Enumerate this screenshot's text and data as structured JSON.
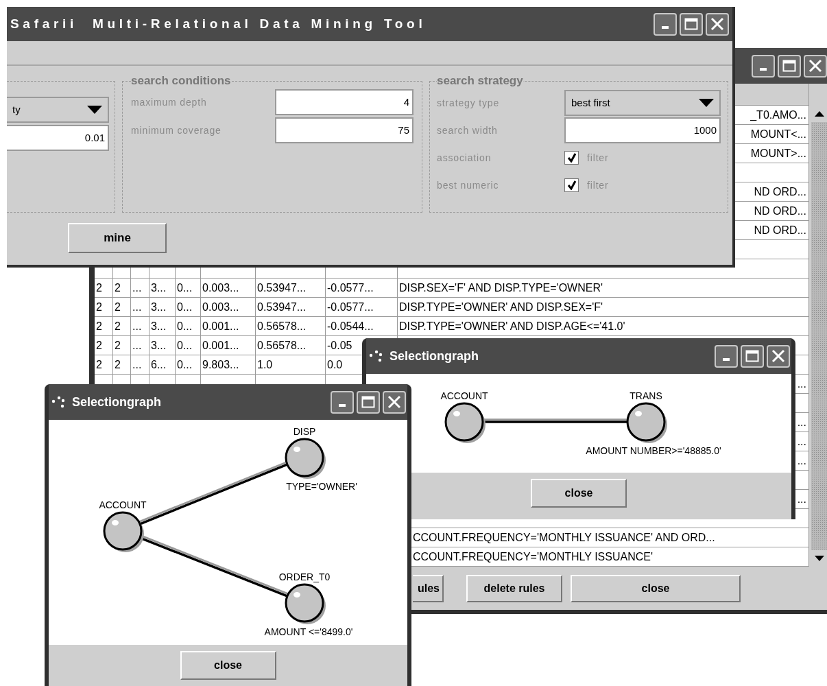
{
  "main_window": {
    "title": "Safarii  Multi-Relational Data Mining Tool",
    "left_panel": {
      "selector_value": "ty",
      "field_value": "0.01"
    },
    "search_conditions": {
      "title": "search conditions",
      "fields": [
        {
          "label": "maximum depth",
          "value": "4"
        },
        {
          "label": "minimum coverage",
          "value": "75"
        }
      ]
    },
    "search_strategy": {
      "title": "search strategy",
      "rows": [
        {
          "kind": "combo",
          "label": "strategy type",
          "value": "best first"
        },
        {
          "kind": "field",
          "label": "search width",
          "value": "1000"
        },
        {
          "kind": "checkbox",
          "label": "association",
          "checked": true,
          "text": "filter"
        },
        {
          "kind": "checkbox",
          "label": "best numeric",
          "checked": true,
          "text": "filter"
        }
      ]
    },
    "mine_button": "mine"
  },
  "results_window": {
    "rows": [
      {
        "kind": "tail",
        "rule": "_T0.AMO..."
      },
      {
        "kind": "tail",
        "rule": "MOUNT<..."
      },
      {
        "kind": "tail",
        "rule": "MOUNT>..."
      },
      {
        "kind": "blank"
      },
      {
        "kind": "tail",
        "rule": "ND ORD..."
      },
      {
        "kind": "tail",
        "rule": "ND ORD..."
      },
      {
        "kind": "tail",
        "rule": "ND ORD..."
      },
      {
        "kind": "blank"
      },
      {
        "kind": "blank"
      },
      {
        "kind": "full",
        "values": [
          "2",
          "2",
          "...",
          "3...",
          "0...",
          "0.003...",
          "0.53947...",
          "-0.0577..."
        ],
        "rule": "DISP.SEX='F' AND DISP.TYPE='OWNER'"
      },
      {
        "kind": "full",
        "values": [
          "2",
          "2",
          "...",
          "3...",
          "0...",
          "0.003...",
          "0.53947...",
          "-0.0577..."
        ],
        "rule": "DISP.TYPE='OWNER' AND DISP.SEX='F'"
      },
      {
        "kind": "full",
        "values": [
          "2",
          "2",
          "...",
          "3...",
          "0...",
          "0.001...",
          "0.56578...",
          "-0.0544..."
        ],
        "rule": "DISP.TYPE='OWNER' AND DISP.AGE<='41.0'"
      },
      {
        "kind": "full",
        "values": [
          "2",
          "2",
          "...",
          "3...",
          "0...",
          "0.001...",
          "0.56578...",
          "-0.05"
        ]
      },
      {
        "kind": "full",
        "values": [
          "2",
          "2",
          "...",
          "6...",
          "0...",
          "9.803...",
          "1.0",
          "0.0"
        ]
      },
      {
        "kind": "tail",
        "rule": "..."
      },
      {
        "kind": "blank"
      },
      {
        "kind": "tail",
        "rule": "..."
      },
      {
        "kind": "tail",
        "rule": "..."
      },
      {
        "kind": "tail",
        "rule": "..."
      },
      {
        "kind": "blank"
      },
      {
        "kind": "tail",
        "rule": "..."
      },
      {
        "kind": "blank"
      },
      {
        "kind": "clipped",
        "rule": "CCOUNT.FREQUENCY='MONTHLY ISSUANCE' AND ORD..."
      },
      {
        "kind": "clipped",
        "rule": "CCOUNT.FREQUENCY='MONTHLY ISSUANCE'"
      }
    ],
    "buttons": [
      "ules",
      "delete rules",
      "close"
    ]
  },
  "selection_graphs": [
    {
      "title": "Selectiongraph",
      "graph": {
        "label": "ACCOUNT",
        "children": [
          {
            "label": "TRANS",
            "condition": "AMOUNT NUMBER>='48885.0'"
          }
        ]
      },
      "button": "close"
    },
    {
      "title": "Selectiongraph",
      "graph": {
        "label": "ACCOUNT",
        "children": [
          {
            "label": "DISP",
            "condition": "TYPE='OWNER'"
          },
          {
            "label": "ORDER_T0",
            "condition": "AMOUNT <='8499.0'"
          }
        ]
      },
      "button": "close"
    }
  ]
}
